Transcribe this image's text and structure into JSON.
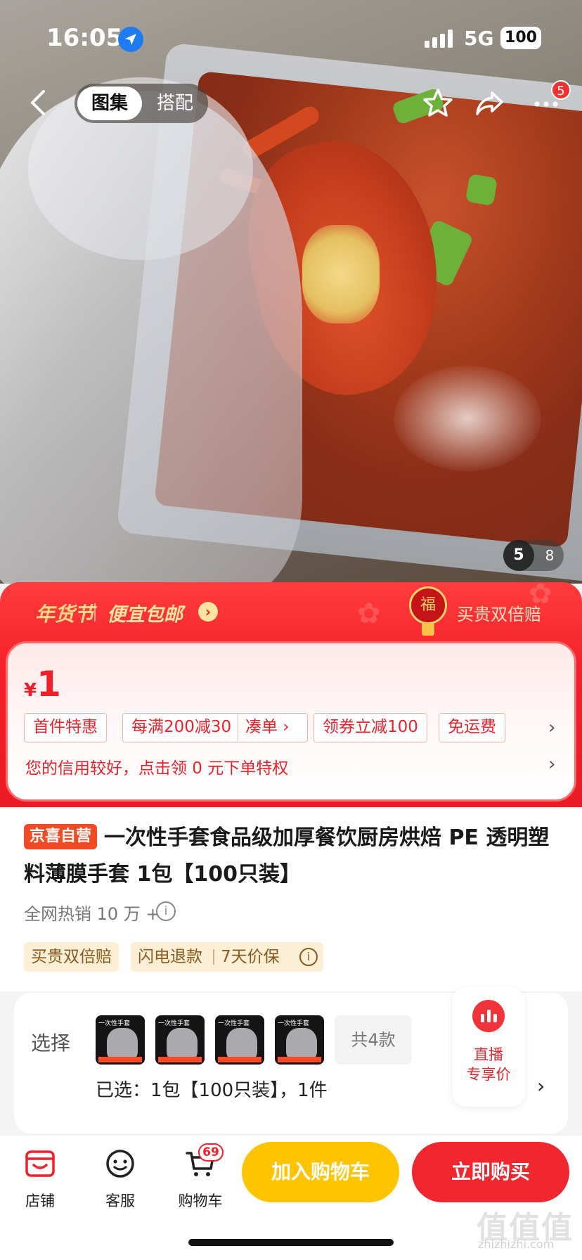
{
  "status_bar": {
    "time": "16:05",
    "network": "5G",
    "battery": "100"
  },
  "nav": {
    "tabs": [
      {
        "label": "图集",
        "active": true
      },
      {
        "label": "搭配",
        "active": false
      }
    ],
    "more_badge": "5"
  },
  "gallery": {
    "current": "5",
    "total": "8"
  },
  "promo": {
    "festival": "年货节",
    "cheap_shipping": "便宜包邮",
    "fu_char": "福",
    "double_comp": "买贵双倍赔"
  },
  "price": {
    "currency": "¥",
    "amount": "1",
    "tags": [
      "首件特惠",
      "每满200减30",
      "凑单 ›",
      "领券立减100",
      "免运费"
    ],
    "credit_text": "您的信用较好，点击领 0 元下单特权"
  },
  "product": {
    "badge": "京喜自营",
    "title": "一次性手套食品级加厚餐饮厨房烘焙 PE 透明塑料薄膜手套 1包【100只装】",
    "sales": "全网热销 10 万 +",
    "guarantees": [
      "买贵双倍赔",
      "闪电退款",
      "7天价保"
    ]
  },
  "selection": {
    "label": "选择",
    "thumb_text": "一次性手套",
    "more_count": "共4款",
    "live_line1": "直播",
    "live_line2": "专享价",
    "selected": "已选：1包【100只装】，1件"
  },
  "bottom_bar": {
    "shop": "店铺",
    "service": "客服",
    "cart": "购物车",
    "cart_count": "69",
    "add_to_cart": "加入购物车",
    "buy_now": "立即购买"
  },
  "watermark": {
    "logo": "值值值",
    "url": "zhizhizhi.com"
  },
  "colors": {
    "brand_red": "#f1262f",
    "cart_yellow": "#ffc400"
  }
}
